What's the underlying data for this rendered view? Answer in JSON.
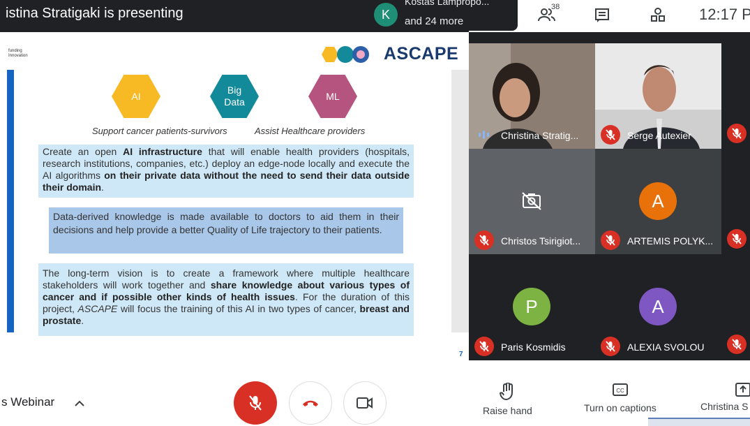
{
  "top_bar": {
    "presenting_label": "istina Stratigaki is presenting",
    "toast_avatar": "K",
    "toast_line1": "Kostas Lampropo...",
    "toast_line2": "and 24 more",
    "participants_count": "38",
    "clock": "12:17 P"
  },
  "slide": {
    "funding_line1": "funding",
    "funding_line2": "Innovation",
    "logo_text": "ASCAPE",
    "hex_ai": "AI",
    "hex_bigdata_1": "Big",
    "hex_bigdata_2": "Data",
    "hex_ml": "ML",
    "caption_left": "Support cancer patients-survivors",
    "caption_right": "Assist Healthcare providers",
    "box1_parts": [
      "Create an open ",
      "AI infrastructure",
      " that will enable health providers (hospitals, research institutions, companies, etc.) deploy an edge-node locally and execute the AI algorithms ",
      "on their private data without the need to send their data outside their domain",
      "."
    ],
    "box2": "Data-derived knowledge is made available to doctors to aid them in their decisions and help provide a better Quality of Life trajectory to their patients.",
    "box3_parts": [
      "The long-term vision is to create a framework where multiple healthcare stakeholders will work together and ",
      "share knowledge about various types of cancer and if possible other kinds of health issues",
      ". For the duration of this project, ",
      "ASCAPE",
      " will focus the training of this AI in two types of cancer, ",
      "breast and prostate",
      "."
    ],
    "page_number": "7"
  },
  "participants": [
    {
      "name": "Christina Stratig...",
      "muted": false
    },
    {
      "name": "Serge Autexier",
      "muted": true
    },
    {
      "name": "Christos Tsirigiot...",
      "muted": true,
      "camera_off": true
    },
    {
      "name": "ARTEMIS POLYK...",
      "muted": true,
      "initial": "A"
    },
    {
      "name": "Paris Kosmidis",
      "muted": true,
      "initial": "P"
    },
    {
      "name": "ALEXIA SVOLOU",
      "muted": true,
      "initial": "A"
    }
  ],
  "bottom": {
    "meeting_title": "s Webinar",
    "raise_hand": "Raise hand",
    "captions": "Turn on captions",
    "present": "Christina S"
  },
  "colors": {
    "mic_off": "#d93025",
    "avatar_artemis": "#e8710a",
    "avatar_paris": "#7cb342",
    "avatar_alexia": "#7e57c2",
    "hex_ai": "#f7b924",
    "hex_bigdata": "#128a9a",
    "hex_ml": "#b5547f"
  }
}
